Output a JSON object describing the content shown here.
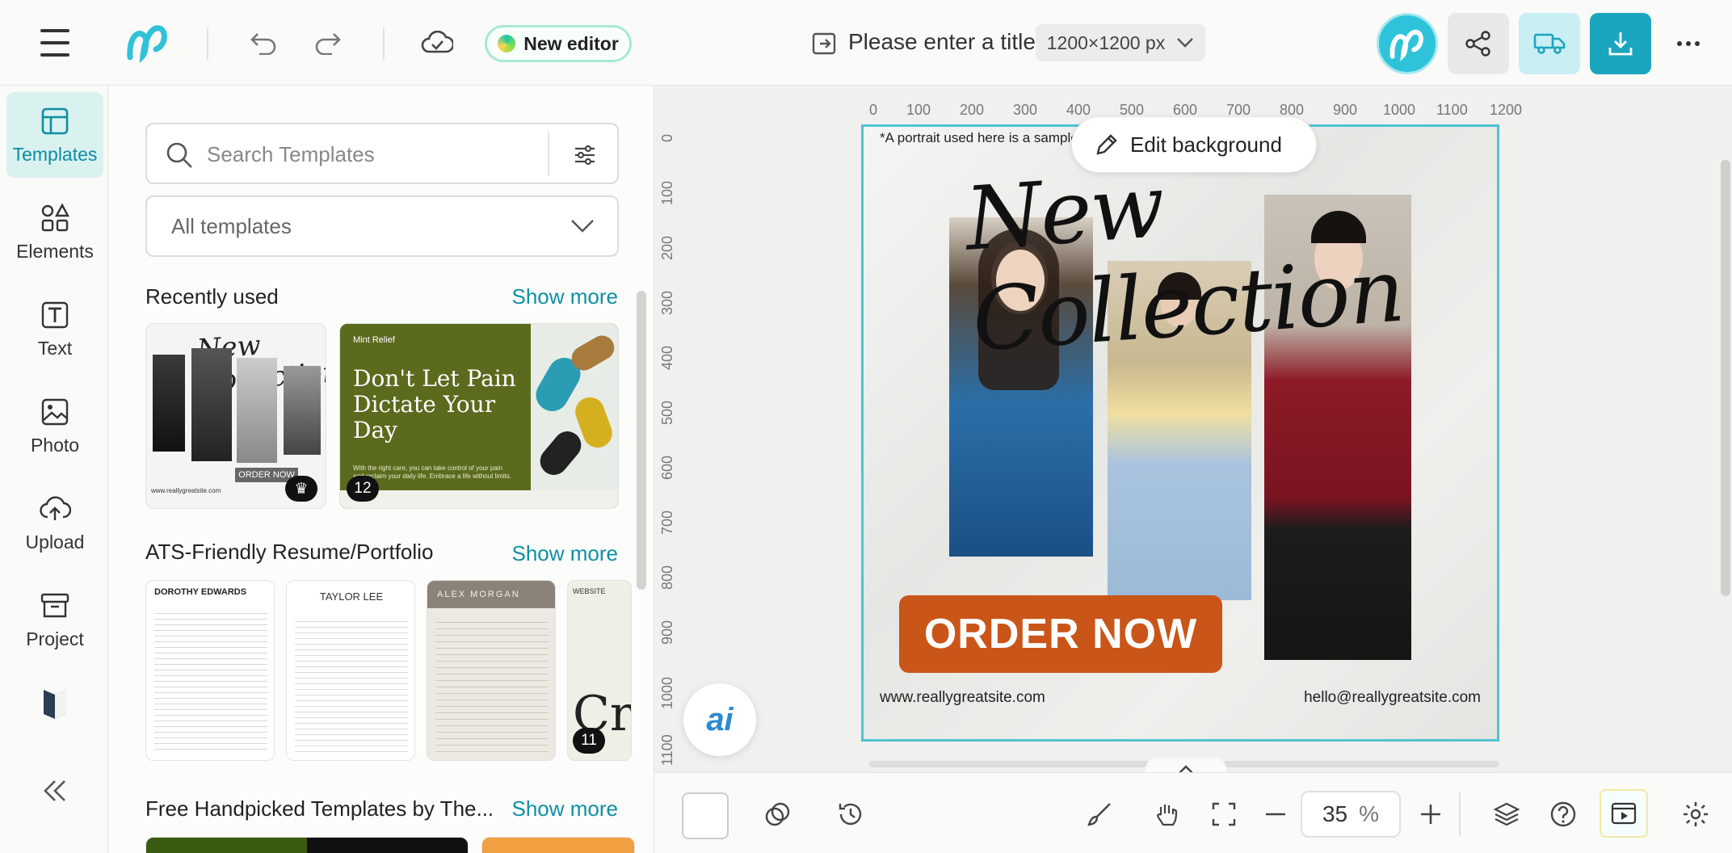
{
  "header": {
    "new_editor_label": "New editor",
    "title_placeholder": "Please enter a title.",
    "canvas_size": "1200×1200 px"
  },
  "leftnav": {
    "items": [
      {
        "label": "Templates"
      },
      {
        "label": "Elements"
      },
      {
        "label": "Text"
      },
      {
        "label": "Photo"
      },
      {
        "label": "Upload"
      },
      {
        "label": "Project"
      }
    ]
  },
  "panel": {
    "search_placeholder": "Search Templates",
    "filter_selected": "All templates",
    "sections": [
      {
        "title": "Recently used",
        "show_more": "Show more"
      },
      {
        "title": "ATS-Friendly Resume/Portfolio",
        "show_more": "Show more"
      },
      {
        "title": "Free Handpicked Templates by The...",
        "show_more": "Show more"
      }
    ],
    "recent_thumbs": [
      {
        "badge": "",
        "order_label": "ORDER NOW",
        "site": "www.reallygreatsite.com"
      },
      {
        "badge": "12",
        "heading": "Don't Let Pain Dictate Your Day",
        "tag": "Mint Relief",
        "body": "With the right care, you can take control of your pain and reclaim your daily life. Embrace a life without limits."
      }
    ],
    "resume_thumbs": [
      {
        "name": "DOROTHY EDWARDS"
      },
      {
        "name": "TAYLOR LEE"
      },
      {
        "name": "ALEX MORGAN"
      },
      {
        "badge": "11",
        "name": "WEBSITE"
      }
    ]
  },
  "canvas": {
    "ruler_top": [
      "0",
      "100",
      "200",
      "300",
      "400",
      "500",
      "600",
      "700",
      "800",
      "900",
      "1000",
      "1100",
      "1200"
    ],
    "ruler_left": [
      "0",
      "100",
      "200",
      "300",
      "400",
      "500",
      "600",
      "700",
      "800",
      "900",
      "1000",
      "1100"
    ],
    "sample_note": "*A portrait used here is a sample image.",
    "headline": "New Collection",
    "order_button": "ORDER NOW",
    "website": "www.reallygreatsite.com",
    "email": "hello@reallygreatsite.com",
    "edit_background_label": "Edit background",
    "ai_label": "ai"
  },
  "bottom": {
    "zoom_value": "35",
    "zoom_unit": "%"
  },
  "colors": {
    "accent": "#1aa6be",
    "accent_light": "#d9f1ef",
    "order_button": "#c95518",
    "link": "#0e90a3"
  }
}
